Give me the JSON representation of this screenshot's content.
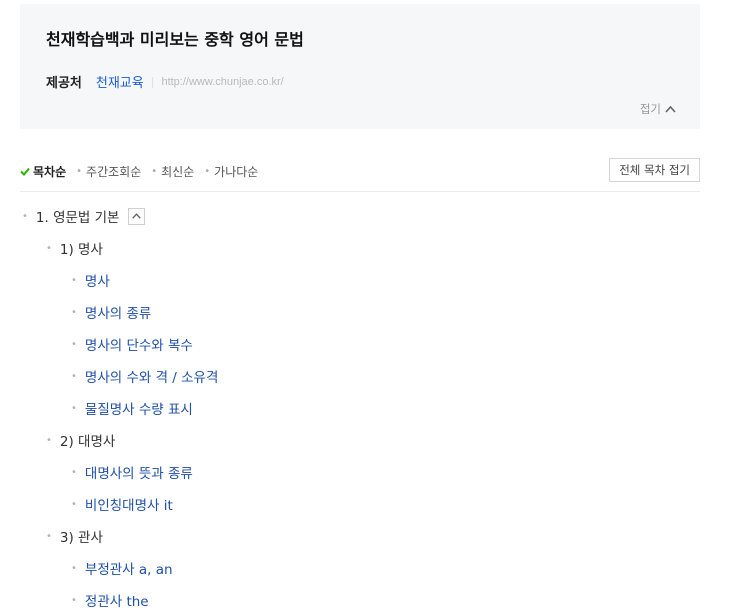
{
  "book": {
    "title": "천재학습백과 미리보는 중학 영어 문법",
    "provider_label": "제공처",
    "provider_name": "천재교육",
    "provider_url": "http://www.chunjae.co.kr/",
    "fold_label": "접기"
  },
  "sort": {
    "items": [
      {
        "label": "목차순",
        "active": true
      },
      {
        "label": "주간조회순",
        "active": false
      },
      {
        "label": "최신순",
        "active": false
      },
      {
        "label": "가나다순",
        "active": false
      }
    ],
    "collapse_all_label": "전체 목차 접기"
  },
  "toc": [
    {
      "level": 1,
      "label": "1. 영문법 기본",
      "collapsible": true
    },
    {
      "level": 2,
      "label": "1) 명사"
    },
    {
      "level": 3,
      "label": "명사"
    },
    {
      "level": 3,
      "label": "명사의 종류"
    },
    {
      "level": 3,
      "label": "명사의 단수와 복수"
    },
    {
      "level": 3,
      "label": "명사의 수와 격 / 소유격"
    },
    {
      "level": 3,
      "label": "물질명사 수량 표시"
    },
    {
      "level": 2,
      "label": "2) 대명사"
    },
    {
      "level": 3,
      "label": "대명사의 뜻과 종류"
    },
    {
      "level": 3,
      "label": "비인칭대명사 it"
    },
    {
      "level": 2,
      "label": "3) 관사"
    },
    {
      "level": 3,
      "label": "부정관사 a, an"
    },
    {
      "level": 3,
      "label": "정관사 the"
    }
  ],
  "colors": {
    "link": "#1f4fa8",
    "accent_check": "#2db400",
    "panel_bg": "#f6f7f9"
  }
}
